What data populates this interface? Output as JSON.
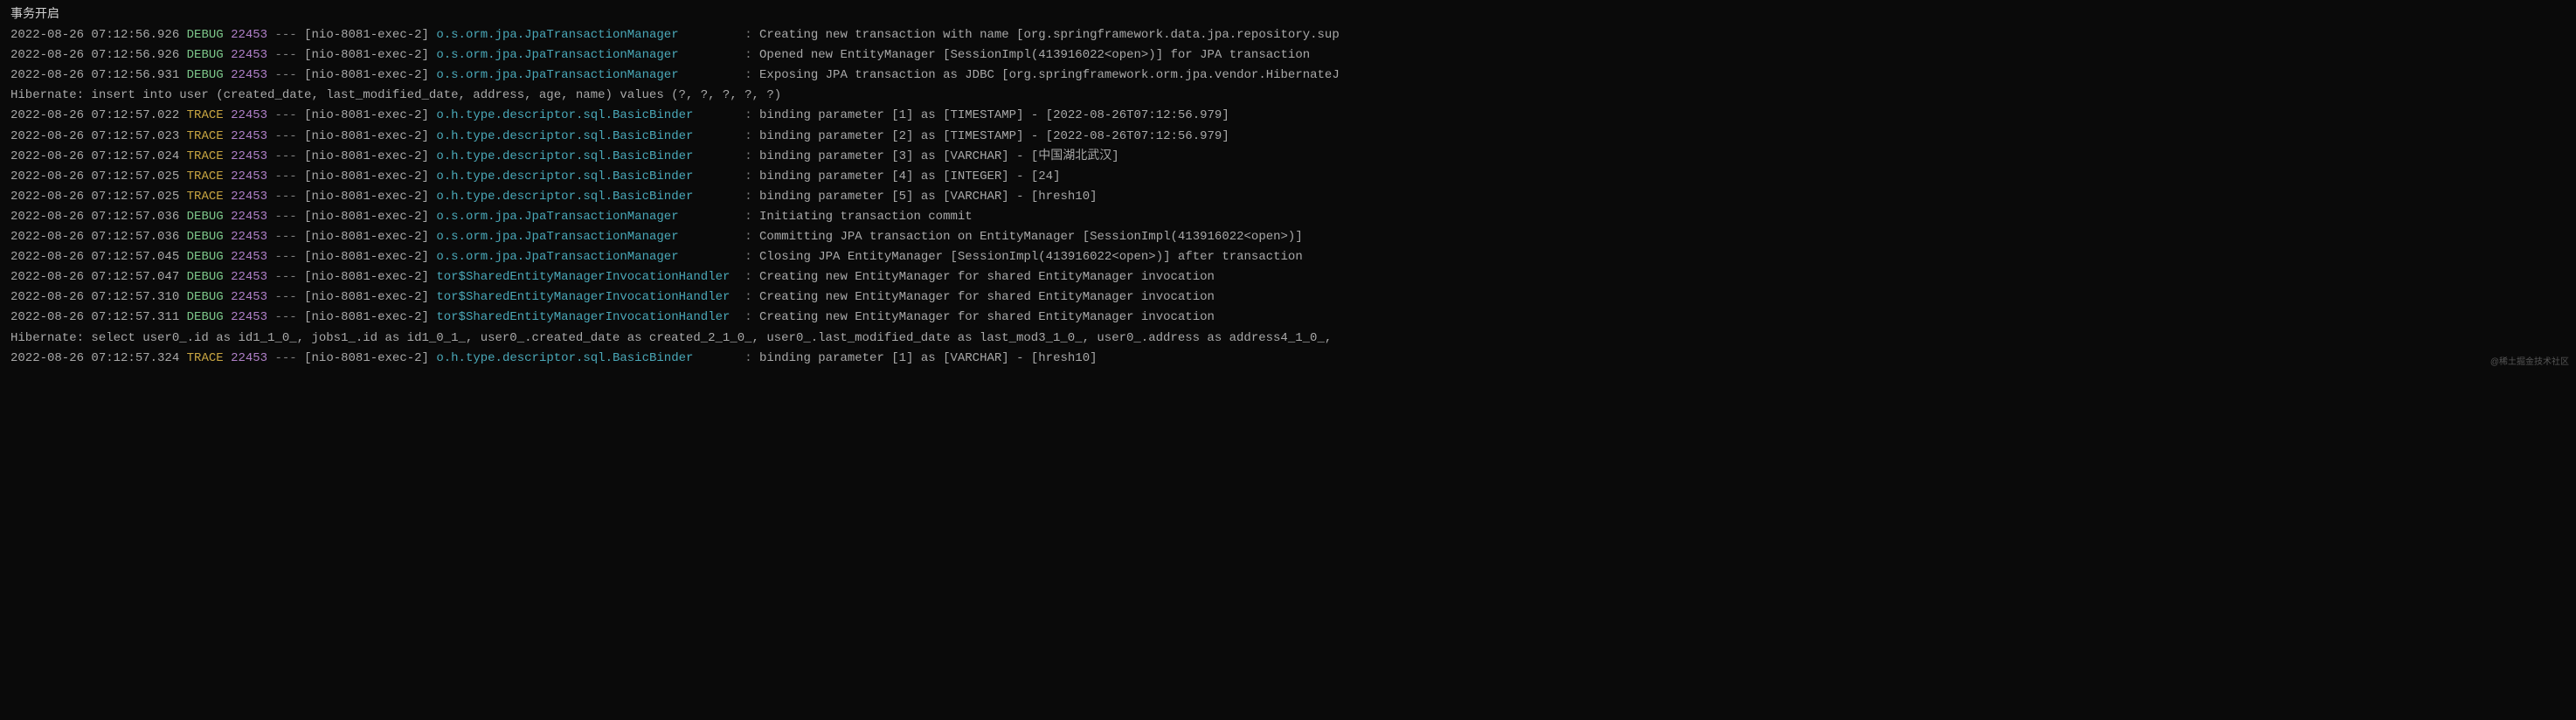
{
  "header": "事务开启",
  "watermark": "@稀土掘金技术社区",
  "logger_width": 41,
  "lines": [
    {
      "type": "log",
      "ts": "2022-08-26 07:12:56.926",
      "level": "DEBUG",
      "pid": "22453",
      "thread": "[nio-8081-exec-2]",
      "logger": "o.s.orm.jpa.JpaTransactionManager",
      "msg": "Creating new transaction with name [org.springframework.data.jpa.repository.sup"
    },
    {
      "type": "log",
      "ts": "2022-08-26 07:12:56.926",
      "level": "DEBUG",
      "pid": "22453",
      "thread": "[nio-8081-exec-2]",
      "logger": "o.s.orm.jpa.JpaTransactionManager",
      "msg": "Opened new EntityManager [SessionImpl(413916022<open>)] for JPA transaction"
    },
    {
      "type": "log",
      "ts": "2022-08-26 07:12:56.931",
      "level": "DEBUG",
      "pid": "22453",
      "thread": "[nio-8081-exec-2]",
      "logger": "o.s.orm.jpa.JpaTransactionManager",
      "msg": "Exposing JPA transaction as JDBC [org.springframework.orm.jpa.vendor.HibernateJ"
    },
    {
      "type": "plain",
      "text": "Hibernate: insert into user (created_date, last_modified_date, address, age, name) values (?, ?, ?, ?, ?)"
    },
    {
      "type": "log",
      "ts": "2022-08-26 07:12:57.022",
      "level": "TRACE",
      "pid": "22453",
      "thread": "[nio-8081-exec-2]",
      "logger": "o.h.type.descriptor.sql.BasicBinder",
      "msg": "binding parameter [1] as [TIMESTAMP] - [2022-08-26T07:12:56.979]"
    },
    {
      "type": "log",
      "ts": "2022-08-26 07:12:57.023",
      "level": "TRACE",
      "pid": "22453",
      "thread": "[nio-8081-exec-2]",
      "logger": "o.h.type.descriptor.sql.BasicBinder",
      "msg": "binding parameter [2] as [TIMESTAMP] - [2022-08-26T07:12:56.979]"
    },
    {
      "type": "log",
      "ts": "2022-08-26 07:12:57.024",
      "level": "TRACE",
      "pid": "22453",
      "thread": "[nio-8081-exec-2]",
      "logger": "o.h.type.descriptor.sql.BasicBinder",
      "msg": "binding parameter [3] as [VARCHAR] - [中国湖北武汉]"
    },
    {
      "type": "log",
      "ts": "2022-08-26 07:12:57.025",
      "level": "TRACE",
      "pid": "22453",
      "thread": "[nio-8081-exec-2]",
      "logger": "o.h.type.descriptor.sql.BasicBinder",
      "msg": "binding parameter [4] as [INTEGER] - [24]"
    },
    {
      "type": "log",
      "ts": "2022-08-26 07:12:57.025",
      "level": "TRACE",
      "pid": "22453",
      "thread": "[nio-8081-exec-2]",
      "logger": "o.h.type.descriptor.sql.BasicBinder",
      "msg": "binding parameter [5] as [VARCHAR] - [hresh10]"
    },
    {
      "type": "log",
      "ts": "2022-08-26 07:12:57.036",
      "level": "DEBUG",
      "pid": "22453",
      "thread": "[nio-8081-exec-2]",
      "logger": "o.s.orm.jpa.JpaTransactionManager",
      "msg": "Initiating transaction commit"
    },
    {
      "type": "log",
      "ts": "2022-08-26 07:12:57.036",
      "level": "DEBUG",
      "pid": "22453",
      "thread": "[nio-8081-exec-2]",
      "logger": "o.s.orm.jpa.JpaTransactionManager",
      "msg": "Committing JPA transaction on EntityManager [SessionImpl(413916022<open>)]"
    },
    {
      "type": "log",
      "ts": "2022-08-26 07:12:57.045",
      "level": "DEBUG",
      "pid": "22453",
      "thread": "[nio-8081-exec-2]",
      "logger": "o.s.orm.jpa.JpaTransactionManager",
      "msg": "Closing JPA EntityManager [SessionImpl(413916022<open>)] after transaction"
    },
    {
      "type": "log",
      "ts": "2022-08-26 07:12:57.047",
      "level": "DEBUG",
      "pid": "22453",
      "thread": "[nio-8081-exec-2]",
      "logger": "tor$SharedEntityManagerInvocationHandler",
      "msg": "Creating new EntityManager for shared EntityManager invocation"
    },
    {
      "type": "log",
      "ts": "2022-08-26 07:12:57.310",
      "level": "DEBUG",
      "pid": "22453",
      "thread": "[nio-8081-exec-2]",
      "logger": "tor$SharedEntityManagerInvocationHandler",
      "msg": "Creating new EntityManager for shared EntityManager invocation"
    },
    {
      "type": "log",
      "ts": "2022-08-26 07:12:57.311",
      "level": "DEBUG",
      "pid": "22453",
      "thread": "[nio-8081-exec-2]",
      "logger": "tor$SharedEntityManagerInvocationHandler",
      "msg": "Creating new EntityManager for shared EntityManager invocation"
    },
    {
      "type": "plain",
      "text": "Hibernate: select user0_.id as id1_1_0_, jobs1_.id as id1_0_1_, user0_.created_date as created_2_1_0_, user0_.last_modified_date as last_mod3_1_0_, user0_.address as address4_1_0_,"
    },
    {
      "type": "log",
      "ts": "2022-08-26 07:12:57.324",
      "level": "TRACE",
      "pid": "22453",
      "thread": "[nio-8081-exec-2]",
      "logger": "o.h.type.descriptor.sql.BasicBinder",
      "msg": "binding parameter [1] as [VARCHAR] - [hresh10]"
    }
  ]
}
